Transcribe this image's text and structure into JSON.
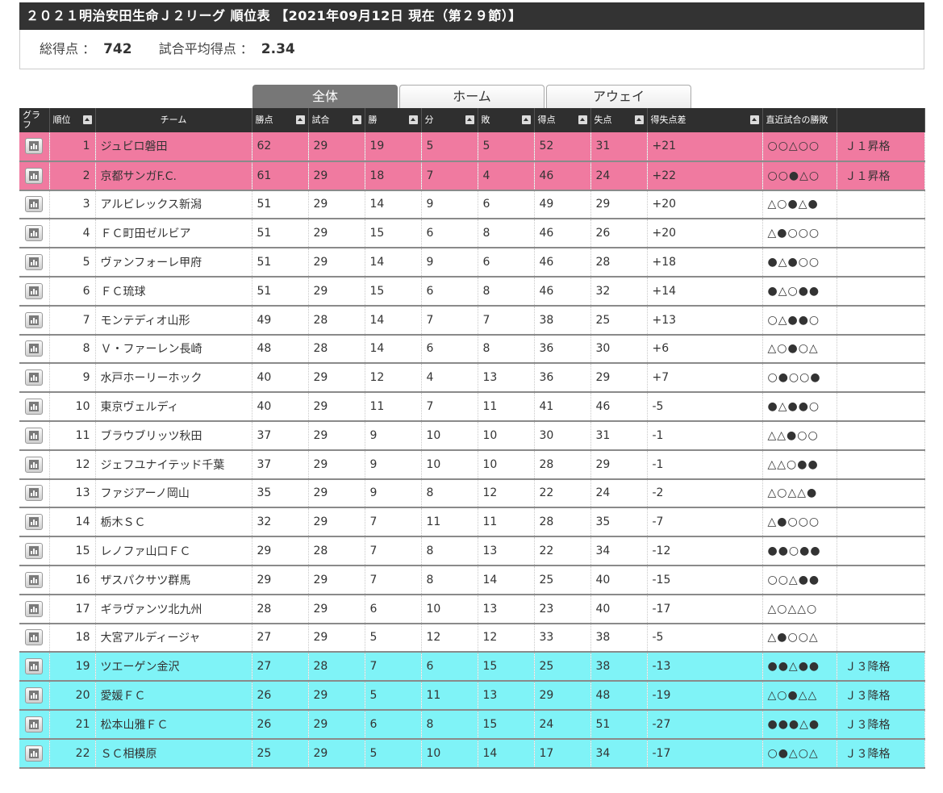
{
  "header": {
    "title": "２０２１明治安田生命Ｊ２リーグ 順位表 【2021年09月12日 現在（第２９節）】"
  },
  "summary": {
    "total_goals_label": "総得点 ：",
    "total_goals": "742",
    "avg_goals_label": "試合平均得点 ：",
    "avg_goals": "2.34"
  },
  "tabs": [
    {
      "label": "全体",
      "active": true
    },
    {
      "label": "ホーム",
      "active": false
    },
    {
      "label": "アウェイ",
      "active": false
    }
  ],
  "columns": {
    "graph": "グラフ",
    "rank": "順位",
    "team": "チーム",
    "points": "勝点",
    "played": "試合",
    "won": "勝",
    "drawn": "分",
    "lost": "敗",
    "gf": "得点",
    "ga": "失点",
    "gd": "得失点差",
    "recent": "直近試合の勝敗"
  },
  "colors": {
    "promotion": "#f07aa0",
    "relegation": "#7ff3f7",
    "header_bg": "#2f2f2f",
    "team_link": "#2a5fa0"
  },
  "rows": [
    {
      "rank": "1",
      "team": "ジュビロ磐田",
      "pts": "62",
      "p": "29",
      "w": "19",
      "d": "5",
      "l": "5",
      "gf": "52",
      "ga": "31",
      "gd": "+21",
      "recent": "○○△○○",
      "status": "Ｊ１昇格",
      "zone": "up"
    },
    {
      "rank": "2",
      "team": "京都サンガF.C.",
      "pts": "61",
      "p": "29",
      "w": "18",
      "d": "7",
      "l": "4",
      "gf": "46",
      "ga": "24",
      "gd": "+22",
      "recent": "○○●△○",
      "status": "Ｊ１昇格",
      "zone": "up"
    },
    {
      "rank": "3",
      "team": "アルビレックス新潟",
      "pts": "51",
      "p": "29",
      "w": "14",
      "d": "9",
      "l": "6",
      "gf": "49",
      "ga": "29",
      "gd": "+20",
      "recent": "△○●△●",
      "status": "",
      "zone": ""
    },
    {
      "rank": "4",
      "team": "ＦＣ町田ゼルビア",
      "pts": "51",
      "p": "29",
      "w": "15",
      "d": "6",
      "l": "8",
      "gf": "46",
      "ga": "26",
      "gd": "+20",
      "recent": "△●○○○",
      "status": "",
      "zone": ""
    },
    {
      "rank": "5",
      "team": "ヴァンフォーレ甲府",
      "pts": "51",
      "p": "29",
      "w": "14",
      "d": "9",
      "l": "6",
      "gf": "46",
      "ga": "28",
      "gd": "+18",
      "recent": "●△●○○",
      "status": "",
      "zone": ""
    },
    {
      "rank": "6",
      "team": "ＦＣ琉球",
      "pts": "51",
      "p": "29",
      "w": "15",
      "d": "6",
      "l": "8",
      "gf": "46",
      "ga": "32",
      "gd": "+14",
      "recent": "●△○●●",
      "status": "",
      "zone": ""
    },
    {
      "rank": "7",
      "team": "モンテディオ山形",
      "pts": "49",
      "p": "28",
      "w": "14",
      "d": "7",
      "l": "7",
      "gf": "38",
      "ga": "25",
      "gd": "+13",
      "recent": "○△●●○",
      "status": "",
      "zone": ""
    },
    {
      "rank": "8",
      "team": "Ｖ・ファーレン長崎",
      "pts": "48",
      "p": "28",
      "w": "14",
      "d": "6",
      "l": "8",
      "gf": "36",
      "ga": "30",
      "gd": "+6",
      "recent": "△○●○△",
      "status": "",
      "zone": ""
    },
    {
      "rank": "9",
      "team": "水戸ホーリーホック",
      "pts": "40",
      "p": "29",
      "w": "12",
      "d": "4",
      "l": "13",
      "gf": "36",
      "ga": "29",
      "gd": "+7",
      "recent": "○●○○●",
      "status": "",
      "zone": ""
    },
    {
      "rank": "10",
      "team": "東京ヴェルディ",
      "pts": "40",
      "p": "29",
      "w": "11",
      "d": "7",
      "l": "11",
      "gf": "41",
      "ga": "46",
      "gd": "-5",
      "recent": "●△●●○",
      "status": "",
      "zone": ""
    },
    {
      "rank": "11",
      "team": "ブラウブリッツ秋田",
      "pts": "37",
      "p": "29",
      "w": "9",
      "d": "10",
      "l": "10",
      "gf": "30",
      "ga": "31",
      "gd": "-1",
      "recent": "△△●○○",
      "status": "",
      "zone": ""
    },
    {
      "rank": "12",
      "team": "ジェフユナイテッド千葉",
      "pts": "37",
      "p": "29",
      "w": "9",
      "d": "10",
      "l": "10",
      "gf": "28",
      "ga": "29",
      "gd": "-1",
      "recent": "△△○●●",
      "status": "",
      "zone": ""
    },
    {
      "rank": "13",
      "team": "ファジアーノ岡山",
      "pts": "35",
      "p": "29",
      "w": "9",
      "d": "8",
      "l": "12",
      "gf": "22",
      "ga": "24",
      "gd": "-2",
      "recent": "△○△△●",
      "status": "",
      "zone": ""
    },
    {
      "rank": "14",
      "team": "栃木ＳＣ",
      "pts": "32",
      "p": "29",
      "w": "7",
      "d": "11",
      "l": "11",
      "gf": "28",
      "ga": "35",
      "gd": "-7",
      "recent": "△●○○○",
      "status": "",
      "zone": ""
    },
    {
      "rank": "15",
      "team": "レノファ山口ＦＣ",
      "pts": "29",
      "p": "28",
      "w": "7",
      "d": "8",
      "l": "13",
      "gf": "22",
      "ga": "34",
      "gd": "-12",
      "recent": "●●○●●",
      "status": "",
      "zone": ""
    },
    {
      "rank": "16",
      "team": "ザスパクサツ群馬",
      "pts": "29",
      "p": "29",
      "w": "7",
      "d": "8",
      "l": "14",
      "gf": "25",
      "ga": "40",
      "gd": "-15",
      "recent": "○○△●●",
      "status": "",
      "zone": ""
    },
    {
      "rank": "17",
      "team": "ギラヴァンツ北九州",
      "pts": "28",
      "p": "29",
      "w": "6",
      "d": "10",
      "l": "13",
      "gf": "23",
      "ga": "40",
      "gd": "-17",
      "recent": "△○△△○",
      "status": "",
      "zone": ""
    },
    {
      "rank": "18",
      "team": "大宮アルディージャ",
      "pts": "27",
      "p": "29",
      "w": "5",
      "d": "12",
      "l": "12",
      "gf": "33",
      "ga": "38",
      "gd": "-5",
      "recent": "△●○○△",
      "status": "",
      "zone": ""
    },
    {
      "rank": "19",
      "team": "ツエーゲン金沢",
      "pts": "27",
      "p": "28",
      "w": "7",
      "d": "6",
      "l": "15",
      "gf": "25",
      "ga": "38",
      "gd": "-13",
      "recent": "●●△●●",
      "status": "Ｊ３降格",
      "zone": "down"
    },
    {
      "rank": "20",
      "team": "愛媛ＦＣ",
      "pts": "26",
      "p": "29",
      "w": "5",
      "d": "11",
      "l": "13",
      "gf": "29",
      "ga": "48",
      "gd": "-19",
      "recent": "△○●△△",
      "status": "Ｊ３降格",
      "zone": "down"
    },
    {
      "rank": "21",
      "team": "松本山雅ＦＣ",
      "pts": "26",
      "p": "29",
      "w": "6",
      "d": "8",
      "l": "15",
      "gf": "24",
      "ga": "51",
      "gd": "-27",
      "recent": "●●●△●",
      "status": "Ｊ３降格",
      "zone": "down"
    },
    {
      "rank": "22",
      "team": "ＳＣ相模原",
      "pts": "25",
      "p": "29",
      "w": "5",
      "d": "10",
      "l": "14",
      "gf": "17",
      "ga": "34",
      "gd": "-17",
      "recent": "○●△○△",
      "status": "Ｊ３降格",
      "zone": "down"
    }
  ]
}
